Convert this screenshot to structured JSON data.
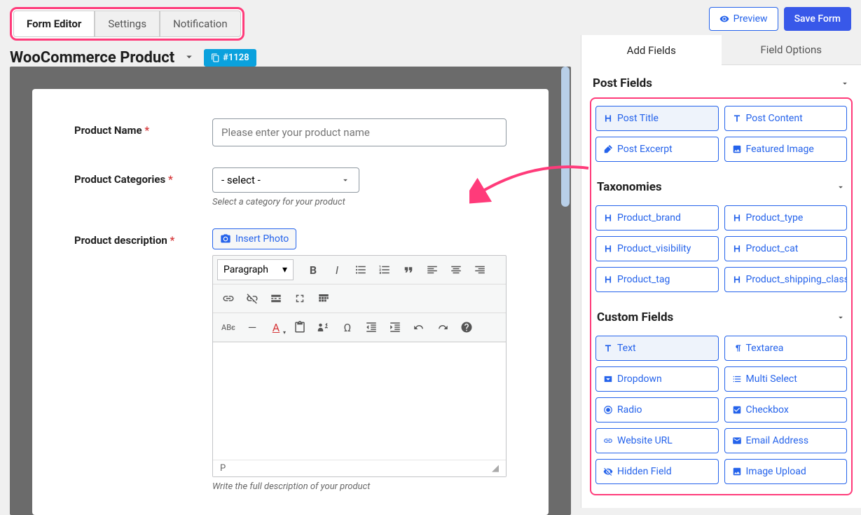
{
  "topbar": {
    "tabs": [
      "Form Editor",
      "Settings",
      "Notification"
    ],
    "preview": "Preview",
    "save": "Save Form"
  },
  "title": {
    "text": "WooCommerce Product",
    "idBadge": "#1128"
  },
  "form": {
    "product_name": {
      "label": "Product Name",
      "placeholder": "Please enter your product name"
    },
    "product_categories": {
      "label": "Product Categories",
      "select_text": "- select -",
      "help": "Select a category for your product"
    },
    "product_description": {
      "label": "Product description",
      "insert_photo": "Insert Photo",
      "paragraph": "Paragraph",
      "status_p": "P",
      "help": "Write the full description of your product"
    }
  },
  "sidebar": {
    "tab_add": "Add Fields",
    "tab_options": "Field Options",
    "sections": {
      "post_fields": {
        "title": "Post Fields",
        "items": [
          "Post Title",
          "Post Content",
          "Post Excerpt",
          "Featured Image"
        ]
      },
      "taxonomies": {
        "title": "Taxonomies",
        "items": [
          "Product_brand",
          "Product_type",
          "Product_visibility",
          "Product_cat",
          "Product_tag",
          "Product_shipping_class"
        ]
      },
      "custom_fields": {
        "title": "Custom Fields",
        "items": [
          "Text",
          "Textarea",
          "Dropdown",
          "Multi Select",
          "Radio",
          "Checkbox",
          "Website URL",
          "Email Address",
          "Hidden Field",
          "Image Upload"
        ]
      }
    }
  }
}
